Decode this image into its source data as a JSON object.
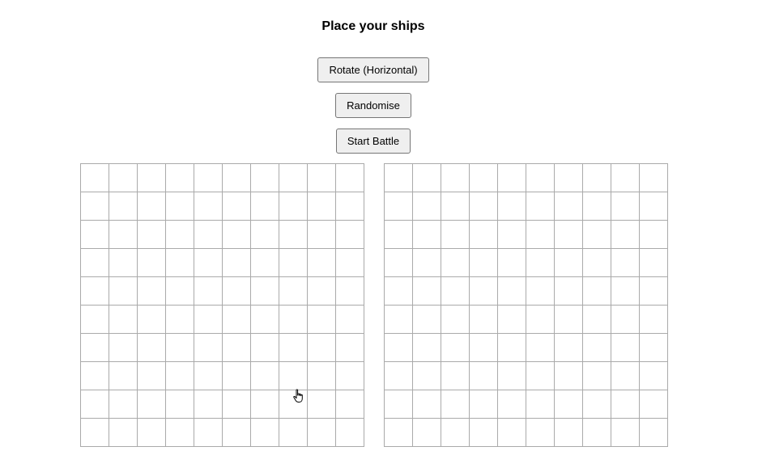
{
  "header": {
    "title": "Place your ships"
  },
  "controls": {
    "rotate_label": "Rotate (Horizontal)",
    "randomise_label": "Randomise",
    "start_label": "Start Battle"
  },
  "boards": {
    "player": {
      "rows": 10,
      "cols": 10
    },
    "enemy": {
      "rows": 10,
      "cols": 10
    }
  },
  "cursor": {
    "icon": "hand-pointer-icon"
  }
}
